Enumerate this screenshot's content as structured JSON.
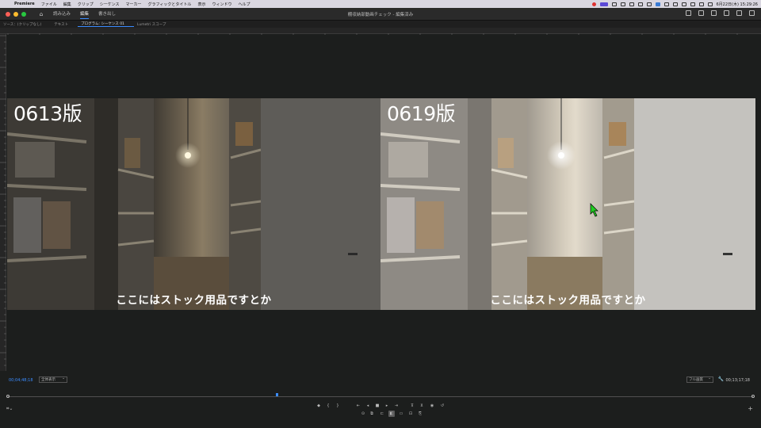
{
  "menubar": {
    "items": [
      "Premiere",
      "ファイル",
      "編集",
      "クリップ",
      "シーケンス",
      "マーカー",
      "グラフィックとタイトル",
      "表示",
      "ウィンドウ",
      "ヘルプ"
    ],
    "clock": "6月22日(木) 15:29:26"
  },
  "titlebar": {
    "workspaces": [
      "読み込み",
      "編集",
      "書き出し"
    ],
    "active_workspace": "編集",
    "document_title": "棚収納部動画チェック - 編集済み"
  },
  "panel_tabs": [
    "ソース：(クリップなし)",
    "テキスト",
    "プログラム: シーケンス 01",
    "Lumetri スコープ"
  ],
  "viewer": {
    "left_label": "0613版",
    "right_label": "0619版",
    "subtitle": "ここにはストック用品ですとか"
  },
  "controls": {
    "timecode_current": "00;04;48;18",
    "fit": "全体表示",
    "resolution": "フル画質",
    "timecode_duration": "00;13;17;18"
  },
  "colors": {
    "accent": "#3b8cff",
    "background": "#1c1e1d"
  }
}
